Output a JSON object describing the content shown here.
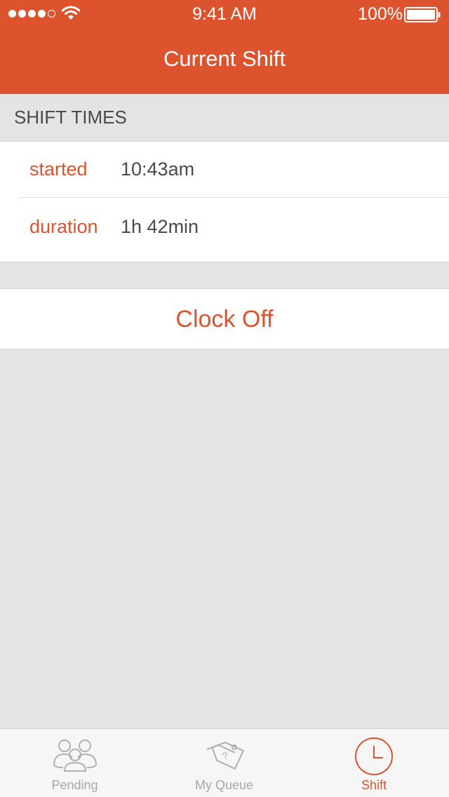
{
  "status_bar": {
    "time": "9:41 AM",
    "battery": "100%",
    "signal_icon": "signal-dots-icon",
    "wifi_icon": "wifi-icon",
    "battery_icon": "battery-icon"
  },
  "header": {
    "title": "Current Shift"
  },
  "section": {
    "title": "SHIFT TIMES"
  },
  "shift_times": [
    {
      "label": "started",
      "value": "10:43am"
    },
    {
      "label": "duration",
      "value": "1h 42min"
    }
  ],
  "action": {
    "clock_off_label": "Clock Off"
  },
  "tabs": [
    {
      "label": "Pending",
      "icon": "people-group-icon",
      "selected": false
    },
    {
      "label": "My Queue",
      "icon": "tags-icon",
      "selected": false
    },
    {
      "label": "Shift",
      "icon": "clock-icon",
      "selected": true
    }
  ],
  "colors": {
    "accent": "#dd532d",
    "background": "#e4e4e4",
    "card": "#ffffff",
    "text": "#4a4a4a",
    "tab_inactive": "#a8a8a8"
  }
}
